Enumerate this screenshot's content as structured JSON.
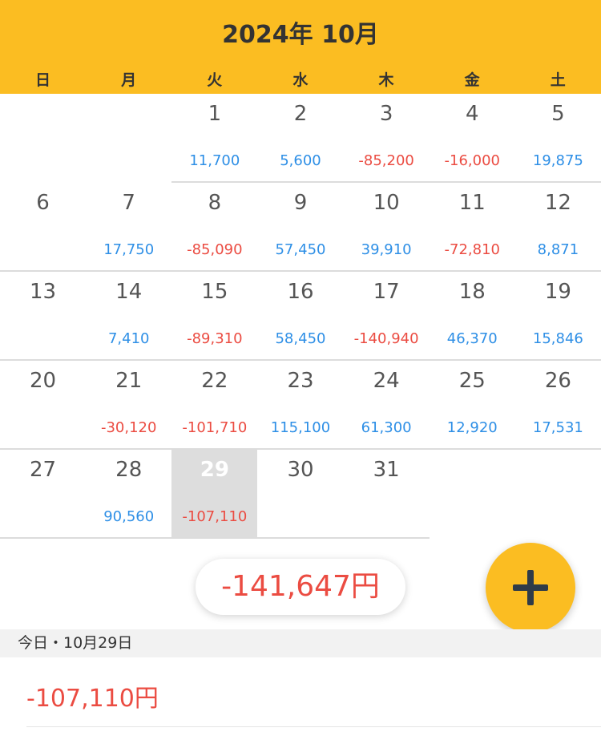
{
  "header": {
    "title": "2024年 10月",
    "background_color": "#FBBD22"
  },
  "weekdays": [
    "日",
    "月",
    "火",
    "水",
    "木",
    "金",
    "土"
  ],
  "calendar": {
    "today": 29,
    "weeks": [
      [
        null,
        null,
        {
          "day": "1",
          "amount": "11,700",
          "sign": "pos"
        },
        {
          "day": "2",
          "amount": "5,600",
          "sign": "pos"
        },
        {
          "day": "3",
          "amount": "-85,200",
          "sign": "neg"
        },
        {
          "day": "4",
          "amount": "-16,000",
          "sign": "neg"
        },
        {
          "day": "5",
          "amount": "19,875",
          "sign": "pos"
        }
      ],
      [
        {
          "day": "6",
          "amount": "",
          "sign": "pos"
        },
        {
          "day": "7",
          "amount": "17,750",
          "sign": "pos"
        },
        {
          "day": "8",
          "amount": "-85,090",
          "sign": "neg"
        },
        {
          "day": "9",
          "amount": "57,450",
          "sign": "pos"
        },
        {
          "day": "10",
          "amount": "39,910",
          "sign": "pos"
        },
        {
          "day": "11",
          "amount": "-72,810",
          "sign": "neg"
        },
        {
          "day": "12",
          "amount": "8,871",
          "sign": "pos"
        }
      ],
      [
        {
          "day": "13",
          "amount": "",
          "sign": "pos"
        },
        {
          "day": "14",
          "amount": "7,410",
          "sign": "pos"
        },
        {
          "day": "15",
          "amount": "-89,310",
          "sign": "neg"
        },
        {
          "day": "16",
          "amount": "58,450",
          "sign": "pos"
        },
        {
          "day": "17",
          "amount": "-140,940",
          "sign": "neg"
        },
        {
          "day": "18",
          "amount": "46,370",
          "sign": "pos"
        },
        {
          "day": "19",
          "amount": "15,846",
          "sign": "pos"
        }
      ],
      [
        {
          "day": "20",
          "amount": "",
          "sign": "pos"
        },
        {
          "day": "21",
          "amount": "-30,120",
          "sign": "neg"
        },
        {
          "day": "22",
          "amount": "-101,710",
          "sign": "neg"
        },
        {
          "day": "23",
          "amount": "115,100",
          "sign": "pos"
        },
        {
          "day": "24",
          "amount": "61,300",
          "sign": "pos"
        },
        {
          "day": "25",
          "amount": "12,920",
          "sign": "pos"
        },
        {
          "day": "26",
          "amount": "17,531",
          "sign": "pos"
        }
      ],
      [
        {
          "day": "27",
          "amount": "",
          "sign": "pos"
        },
        {
          "day": "28",
          "amount": "90,560",
          "sign": "pos"
        },
        {
          "day": "29",
          "amount": "-107,110",
          "sign": "neg"
        },
        {
          "day": "30",
          "amount": "",
          "sign": "pos"
        },
        {
          "day": "31",
          "amount": "",
          "sign": "pos"
        },
        null,
        null
      ]
    ]
  },
  "total": {
    "label": "-141,647円"
  },
  "fab": {
    "icon": "plus-icon"
  },
  "section": {
    "label": "今日・10月29日"
  },
  "entry": {
    "amount": "-107,110円"
  },
  "colors": {
    "positive": "#2E8FE6",
    "negative": "#EB4C42",
    "today_bg": "#DDDDDD"
  }
}
